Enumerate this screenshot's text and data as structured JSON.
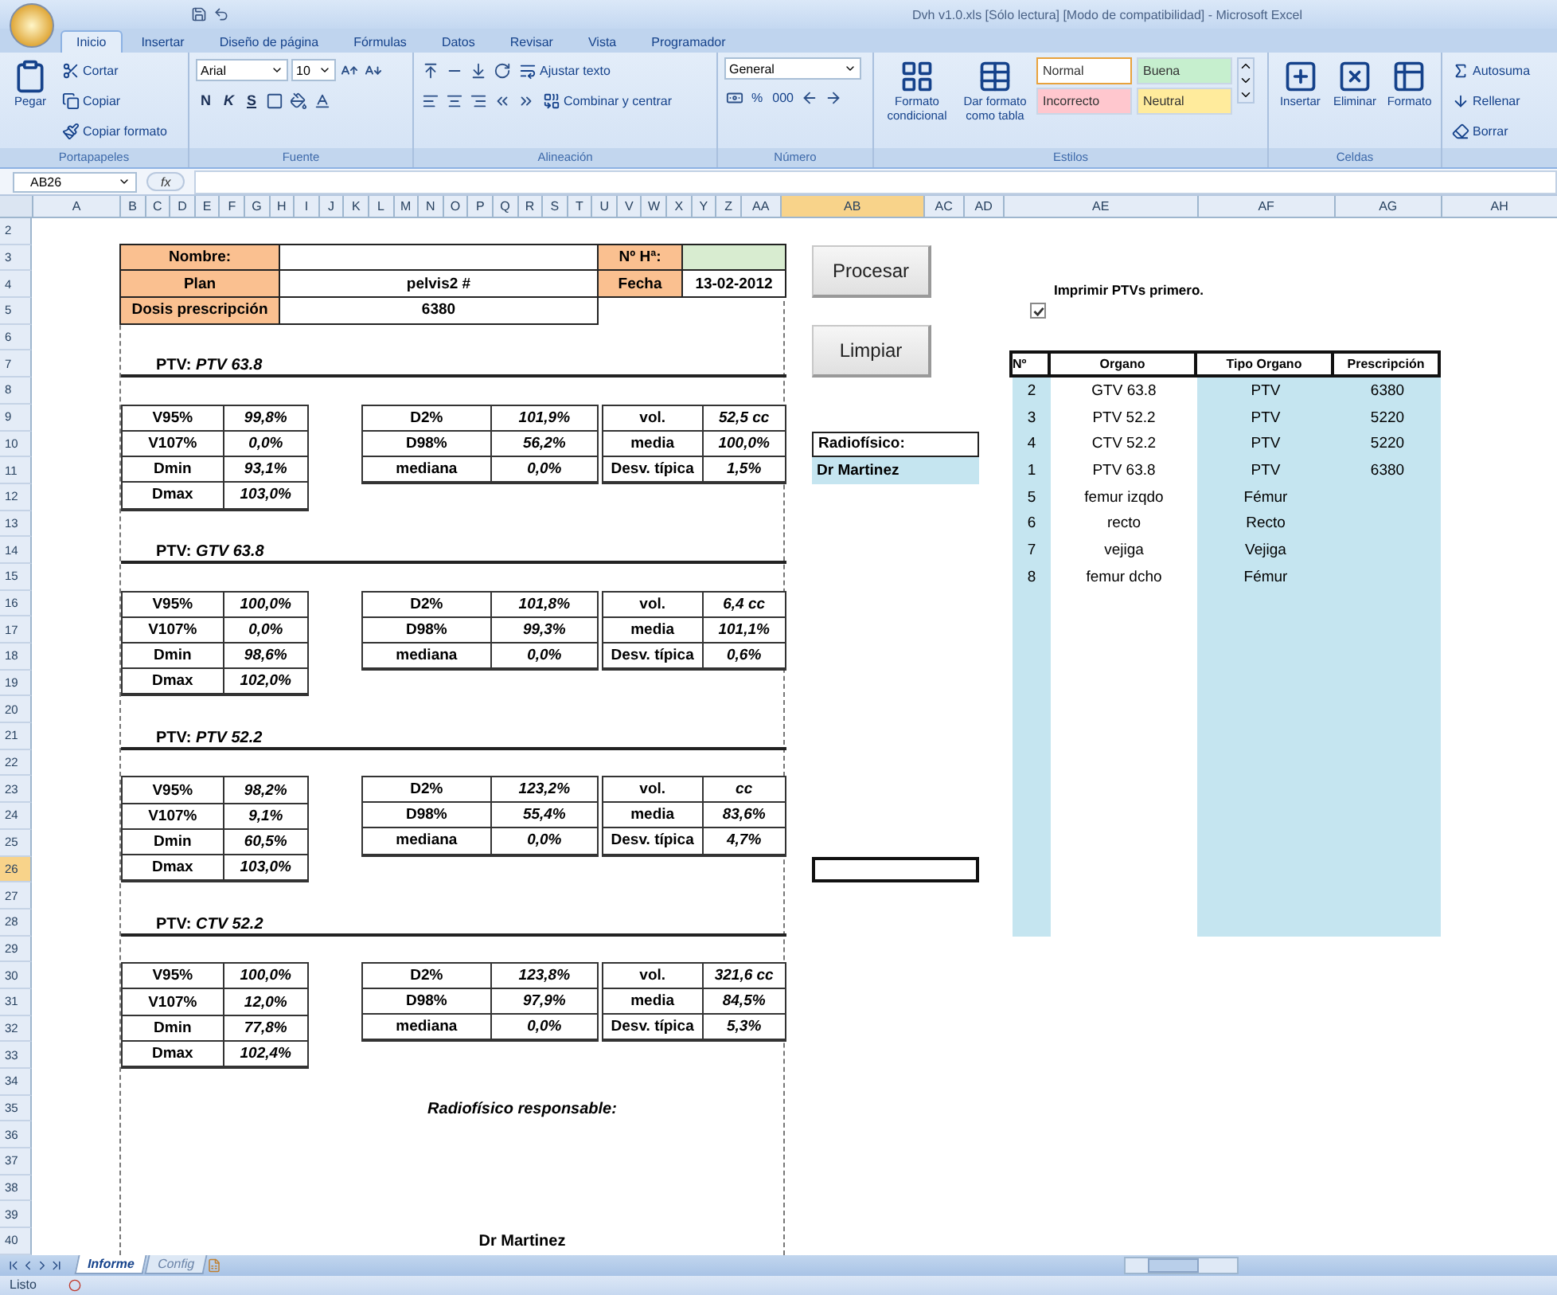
{
  "window": {
    "title": "Dvh v1.0.xls [Sólo lectura] [Modo de compatibilidad] - Microsoft Excel"
  },
  "ribbon_tabs": [
    {
      "label": "Inicio",
      "selected": true
    },
    {
      "label": "Insertar",
      "selected": false
    },
    {
      "label": "Diseño de página",
      "selected": false
    },
    {
      "label": "Fórmulas",
      "selected": false
    },
    {
      "label": "Datos",
      "selected": false
    },
    {
      "label": "Revisar",
      "selected": false
    },
    {
      "label": "Vista",
      "selected": false
    },
    {
      "label": "Programador",
      "selected": false
    }
  ],
  "ribbon_groups": [
    {
      "kind": "clipboard",
      "label": "Portapapeles",
      "main": "Pegar",
      "items": [
        "Cortar",
        "Copiar",
        "Copiar formato"
      ]
    },
    {
      "kind": "font",
      "label": "Fuente",
      "font": "Arial",
      "size": "10",
      "format_buttons": [
        "N",
        "K",
        "S"
      ]
    },
    {
      "kind": "alignment",
      "label": "Alineación",
      "items": [
        "Ajustar texto",
        "Combinar y centrar"
      ]
    },
    {
      "kind": "number",
      "label": "Número",
      "format": "General",
      "items": [
        "%",
        "000"
      ]
    },
    {
      "kind": "styles",
      "label": "Estilos",
      "items": [
        "Formato condicional",
        "Dar formato como tabla"
      ],
      "styles": [
        {
          "label": "Normal",
          "color": "#ffffff",
          "selected": true
        },
        {
          "label": "Buena",
          "color": "#c6efce",
          "selected": false
        },
        {
          "label": "Incorrecto",
          "color": "#ffc7ce",
          "selected": false
        },
        {
          "label": "Neutral",
          "color": "#ffeb9c",
          "selected": false
        }
      ]
    },
    {
      "kind": "cells",
      "label": "Celdas",
      "items": [
        "Insertar",
        "Eliminar",
        "Formato"
      ]
    },
    {
      "kind": "editing",
      "items": [
        "Autosuma",
        "Rellenar",
        "Borrar"
      ]
    }
  ],
  "formula_bar": {
    "name_box": "AB26",
    "function_label": "fx"
  },
  "columns": [
    {
      "label": "A",
      "selected": false
    },
    {
      "label": "B",
      "selected": false
    },
    {
      "label": "C",
      "selected": false
    },
    {
      "label": "D",
      "selected": false
    },
    {
      "label": "E",
      "selected": false
    },
    {
      "label": "F",
      "selected": false
    },
    {
      "label": "G",
      "selected": false
    },
    {
      "label": "H",
      "selected": false
    },
    {
      "label": "I",
      "selected": false
    },
    {
      "label": "J",
      "selected": false
    },
    {
      "label": "K",
      "selected": false
    },
    {
      "label": "L",
      "selected": false
    },
    {
      "label": "M",
      "selected": false
    },
    {
      "label": "N",
      "selected": false
    },
    {
      "label": "O",
      "selected": false
    },
    {
      "label": "P",
      "selected": false
    },
    {
      "label": "Q",
      "selected": false
    },
    {
      "label": "R",
      "selected": false
    },
    {
      "label": "S",
      "selected": false
    },
    {
      "label": "T",
      "selected": false
    },
    {
      "label": "U",
      "selected": false
    },
    {
      "label": "V",
      "selected": false
    },
    {
      "label": "W",
      "selected": false
    },
    {
      "label": "X",
      "selected": false
    },
    {
      "label": "Y",
      "selected": false
    },
    {
      "label": "Z",
      "selected": false
    },
    {
      "label": "AA",
      "selected": false
    },
    {
      "label": "AB",
      "selected": true
    },
    {
      "label": "AC",
      "selected": false
    },
    {
      "label": "AD",
      "selected": false
    },
    {
      "label": "AE",
      "selected": false
    },
    {
      "label": "AF",
      "selected": false
    },
    {
      "label": "AG",
      "selected": false
    },
    {
      "label": "AH",
      "selected": false
    }
  ],
  "rows": [
    {
      "label": "2",
      "selected": false
    },
    {
      "label": "3",
      "selected": false
    },
    {
      "label": "4",
      "selected": false
    },
    {
      "label": "5",
      "selected": false
    },
    {
      "label": "6",
      "selected": false
    },
    {
      "label": "7",
      "selected": false
    },
    {
      "label": "8",
      "selected": false
    },
    {
      "label": "9",
      "selected": false
    },
    {
      "label": "10",
      "selected": false
    },
    {
      "label": "11",
      "selected": false
    },
    {
      "label": "12",
      "selected": false
    },
    {
      "label": "13",
      "selected": false
    },
    {
      "label": "14",
      "selected": false
    },
    {
      "label": "15",
      "selected": false
    },
    {
      "label": "16",
      "selected": false
    },
    {
      "label": "17",
      "selected": false
    },
    {
      "label": "18",
      "selected": false
    },
    {
      "label": "19",
      "selected": false
    },
    {
      "label": "20",
      "selected": false
    },
    {
      "label": "21",
      "selected": false
    },
    {
      "label": "22",
      "selected": false
    },
    {
      "label": "23",
      "selected": false
    },
    {
      "label": "24",
      "selected": false
    },
    {
      "label": "25",
      "selected": false
    },
    {
      "label": "26",
      "selected": true
    },
    {
      "label": "27",
      "selected": false
    },
    {
      "label": "28",
      "selected": false
    },
    {
      "label": "29",
      "selected": false
    },
    {
      "label": "30",
      "selected": false
    },
    {
      "label": "31",
      "selected": false
    },
    {
      "label": "32",
      "selected": false
    },
    {
      "label": "33",
      "selected": false
    },
    {
      "label": "34",
      "selected": false
    },
    {
      "label": "35",
      "selected": false
    },
    {
      "label": "36",
      "selected": false
    },
    {
      "label": "37",
      "selected": false
    },
    {
      "label": "38",
      "selected": false
    },
    {
      "label": "39",
      "selected": false
    },
    {
      "label": "40",
      "selected": false
    }
  ],
  "report": {
    "header_rows": [
      {
        "fields": [
          {
            "label": "Nombre:"
          },
          {
            "label": "Nº Hª:",
            "color": "#d8ecd0"
          }
        ]
      },
      {
        "fields": [
          {
            "label": "Plan",
            "value": "pelvis2 #"
          },
          {
            "label": "Fecha",
            "value": "13-02-2012"
          }
        ]
      },
      {
        "fields": [
          {
            "label": "Dosis prescripción",
            "value": "6380"
          }
        ]
      }
    ],
    "sections": [
      {
        "title": "PTV: *PTV 63.8*",
        "tables": [
          [
            {
              "label": "V95%",
              "value": "99,8%"
            },
            {
              "label": "V107%",
              "value": "0,0%"
            },
            {
              "label": "Dmin",
              "value": "93,1%"
            },
            {
              "label": "Dmax",
              "value": "103,0%"
            }
          ],
          [
            {
              "label": "D2%",
              "value": "101,9%"
            },
            {
              "label": "D98%",
              "value": "56,2%"
            },
            {
              "label": "mediana",
              "value": "0,0%"
            }
          ],
          [
            {
              "label": "vol.",
              "value": "52,5 cc"
            },
            {
              "label": "media",
              "value": "100,0%"
            },
            {
              "label": "Desv. típica",
              "value": "1,5%"
            }
          ]
        ]
      },
      {
        "title": "PTV: *GTV 63.8*",
        "tables": [
          [
            {
              "label": "V95%",
              "value": "100,0%"
            },
            {
              "label": "V107%",
              "value": "0,0%"
            },
            {
              "label": "Dmin",
              "value": "98,6%"
            },
            {
              "label": "Dmax",
              "value": "102,0%"
            }
          ],
          [
            {
              "label": "D2%",
              "value": "101,8%"
            },
            {
              "label": "D98%",
              "value": "99,3%"
            },
            {
              "label": "mediana",
              "value": "0,0%"
            }
          ],
          [
            {
              "label": "vol.",
              "value": "6,4 cc"
            },
            {
              "label": "media",
              "value": "101,1%"
            },
            {
              "label": "Desv. típica",
              "value": "0,6%"
            }
          ]
        ]
      },
      {
        "title": "PTV: *PTV 52.2*",
        "tables": [
          [
            {
              "label": "V95%",
              "value": "98,2%"
            },
            {
              "label": "V107%",
              "value": "9,1%"
            },
            {
              "label": "Dmin",
              "value": "60,5%"
            },
            {
              "label": "Dmax",
              "value": "103,0%"
            }
          ],
          [
            {
              "label": "D2%",
              "value": "123,2%"
            },
            {
              "label": "D98%",
              "value": "55,4%"
            },
            {
              "label": "mediana",
              "value": "0,0%"
            }
          ],
          [
            {
              "label": "vol.",
              "value": "cc"
            },
            {
              "label": "media",
              "value": "83,6%"
            },
            {
              "label": "Desv. típica",
              "value": "4,7%"
            }
          ]
        ]
      },
      {
        "title": "PTV: *CTV 52.2*",
        "tables": [
          [
            {
              "label": "V95%",
              "value": "100,0%"
            },
            {
              "label": "V107%",
              "value": "12,0%"
            },
            {
              "label": "Dmin",
              "value": "77,8%"
            },
            {
              "label": "Dmax",
              "value": "102,4%"
            }
          ],
          [
            {
              "label": "D2%",
              "value": "123,8%"
            },
            {
              "label": "D98%",
              "value": "97,9%"
            },
            {
              "label": "mediana",
              "value": "0,0%"
            }
          ],
          [
            {
              "label": "vol.",
              "value": "321,6 cc"
            },
            {
              "label": "media",
              "value": "84,5%"
            },
            {
              "label": "Desv. típica",
              "value": "5,3%"
            }
          ]
        ]
      }
    ],
    "signature": {
      "label": "Radiofísico responsable:",
      "name": "Dr Martinez"
    }
  },
  "buttons": [
    "Procesar",
    "Limpiar"
  ],
  "physicist": {
    "label": "Radiofísico:",
    "value": "Dr Martinez"
  },
  "print_option": {
    "label": "Imprimir PTVs primero.",
    "checked": true
  },
  "organ_table": {
    "columns": [
      "Nº",
      "Organo",
      "Tipo Organo",
      "Prescripción"
    ],
    "rows": [
      {
        "number": "2",
        "organ": "GTV 63.8",
        "type": "PTV",
        "prescription": "6380"
      },
      {
        "number": "3",
        "organ": "PTV 52.2",
        "type": "PTV",
        "prescription": "5220"
      },
      {
        "number": "4",
        "organ": "CTV 52.2",
        "type": "PTV",
        "prescription": "5220"
      },
      {
        "number": "1",
        "organ": "PTV 63.8",
        "type": "PTV",
        "prescription": "6380"
      },
      {
        "number": "5",
        "organ": "femur izqdo",
        "type": "Fémur"
      },
      {
        "number": "6",
        "organ": "recto",
        "type": "Recto"
      },
      {
        "number": "7",
        "organ": "vejiga",
        "type": "Vejiga"
      },
      {
        "number": "8",
        "organ": "femur dcho",
        "type": "Fémur"
      }
    ]
  },
  "sheet_tabs": [
    {
      "label": "Informe",
      "selected": true
    },
    {
      "label": "Config",
      "selected": false
    }
  ],
  "status_bar": {
    "text": "Listo"
  }
}
